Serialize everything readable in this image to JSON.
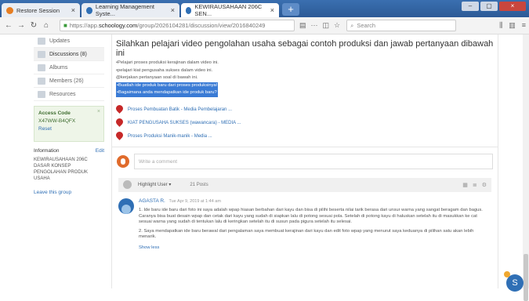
{
  "browser": {
    "tabs": [
      {
        "label": "Restore Session",
        "color": "#e67e22"
      },
      {
        "label": "Learning Management Syste...",
        "color": "#2f6fb5"
      },
      {
        "label": "KEWIRAUSAHAAN 206C SEN...",
        "color": "#2f6fb5"
      }
    ],
    "url_prefix": "https://app.",
    "url_domain": "schoology.com",
    "url_rest": "/group/2026104281/discussion/view/2016840249",
    "search_placeholder": "Search"
  },
  "sidebar": {
    "items": [
      {
        "label": "Updates"
      },
      {
        "label": "Discussions (8)"
      },
      {
        "label": "Albums"
      },
      {
        "label": "Members (26)"
      },
      {
        "label": "Resources"
      }
    ],
    "access_code_title": "Access Code",
    "access_code_value": "X47WW-B4QFX",
    "access_code_reset": "Reset",
    "info_title": "Information",
    "info_edit": "Edit",
    "info_text": "KEWIRAUSAHAAN 206C DASAR KONSEP PENGOLAHAN PRODUK USAHA",
    "leave_label": "Leave this group"
  },
  "main": {
    "title": "Silahkan pelajari video pengolahan usaha sebagai contoh produksi dan jawab pertanyaan dibawah ini",
    "instructions": [
      "•Pelajari proses produksi kerajinan dalam video ini.",
      "•pelajari kiat pengusaha sukses dalam video ini.",
      "@kerjakan pertanyaan soal di bawah ini."
    ],
    "questions": [
      "•Buatlah ide produk baru dari proses produksinya!",
      "•Bagaimana anda mendapatkan ide produk baru?"
    ],
    "links": [
      "Proses Pembuatan Batik - Media Pembelajaran ...",
      "KIAT PENGUSAHA SUKSES (wawancara) - MEDIA ...",
      "Proses Produksi Manik-manik - Media ..."
    ],
    "comment_placeholder": "Write a comment",
    "filter_label": "Highlight User ▾",
    "post_count": "21 Posts",
    "post": {
      "author": "AGASTA R.",
      "time": "Tue Apr 9, 2019 at 1:44 am",
      "p1": "1. Ide baru ide baru dari foto ini saya adalah wpap hiasan berbahan dari kayu dan bisa di pilihi beserta nilai tarik berasa dari unsur warna yang sangat beragam dan bagus. Caranya bisa buat desain wpap dan cetak dari kayu yang sudah di siapkan lalu di potong sesuai pola. Setelah di potong kayu di haluskan setelah itu di masukkan ke cat sesuai warna yang sudah di tentukan lalu di keringkan setelah itu di susun pada pigura setelah itu selesai.",
      "p2": "2. Saya mendapatkan ide baru berawal dari pengalaman saya membuat kerajinan dari kayu dan edit foto wpap yang menurut saya keduanya di pilihan satu akan lebih menarik.",
      "more": "Show less"
    }
  },
  "chat_badge": "S"
}
